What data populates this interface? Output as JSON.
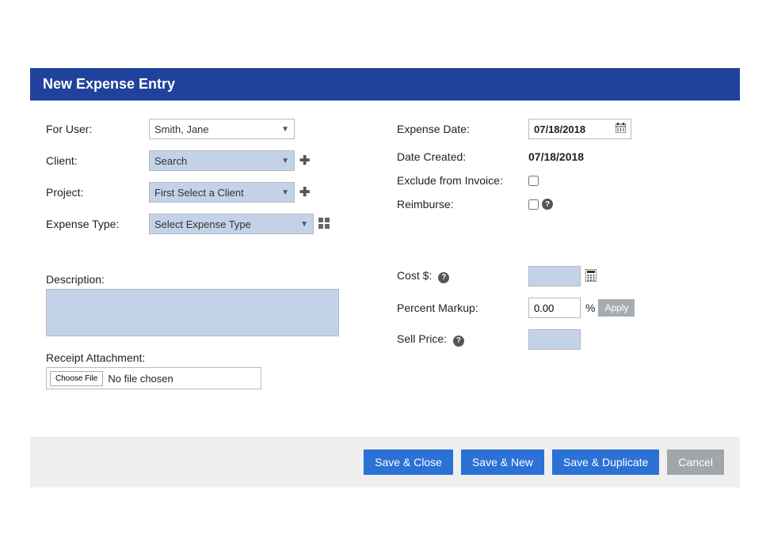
{
  "header": {
    "title": "New Expense Entry"
  },
  "left": {
    "for_user_label": "For User:",
    "for_user_value": "Smith, Jane",
    "client_label": "Client:",
    "client_value": "Search",
    "project_label": "Project:",
    "project_value": "First Select a Client",
    "expense_type_label": "Expense Type:",
    "expense_type_value": "Select Expense Type",
    "description_label": "Description:",
    "description_value": "",
    "receipt_label": "Receipt Attachment:",
    "choose_file_label": "Choose File",
    "file_chosen_text": "No file chosen"
  },
  "right": {
    "expense_date_label": "Expense Date:",
    "expense_date_value": "07/18/2018",
    "date_created_label": "Date Created:",
    "date_created_value": "07/18/2018",
    "exclude_label": "Exclude from Invoice:",
    "reimburse_label": "Reimburse:",
    "cost_label": "Cost $:",
    "cost_value": "",
    "percent_markup_label": "Percent Markup:",
    "percent_markup_value": "0.00",
    "percent_symbol": "%",
    "apply_label": "Apply",
    "sell_price_label": "Sell Price:",
    "sell_price_value": ""
  },
  "footer": {
    "save_close": "Save & Close",
    "save_new": "Save & New",
    "save_duplicate": "Save & Duplicate",
    "cancel": "Cancel"
  }
}
